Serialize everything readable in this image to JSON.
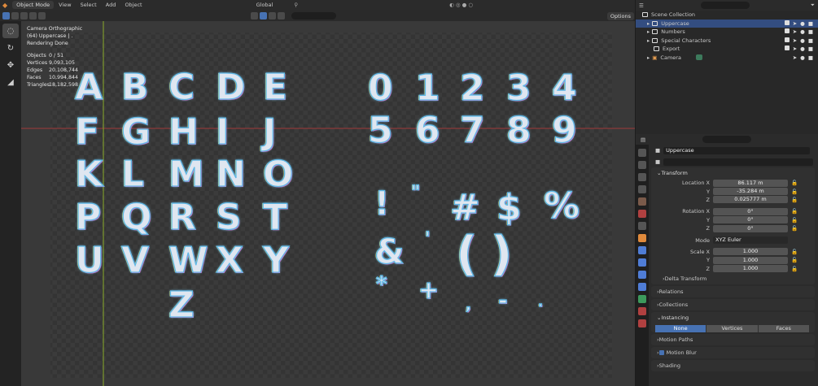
{
  "header": {
    "mode": "Object Mode",
    "menu": [
      "View",
      "Select",
      "Add",
      "Object"
    ],
    "orientation": "Global",
    "options": "Options"
  },
  "overlay": {
    "camera": "Camera Orthographic",
    "collection": "(64) Uppercase | .",
    "status": "Rendering Done",
    "stats": [
      {
        "k": "Objects",
        "v": "0 / 51"
      },
      {
        "k": "Vertices",
        "v": "9,093,105"
      },
      {
        "k": "Edges",
        "v": "20,108,744"
      },
      {
        "k": "Faces",
        "v": "10,994,844"
      },
      {
        "k": "Triangles",
        "v": "18,182,598"
      }
    ]
  },
  "glyphs": {
    "uppercase": "ABCDEFGHIJKLMNOPQRSTUVWXYZ",
    "numbers": "0123456789",
    "special": [
      "!",
      "\"",
      "#",
      "$",
      "%",
      "&",
      "'",
      "(",
      ")",
      "*",
      "+",
      ",",
      "-",
      "."
    ]
  },
  "outliner": {
    "root": "Scene Collection",
    "items": [
      {
        "name": "Uppercase",
        "selected": true
      },
      {
        "name": "Numbers"
      },
      {
        "name": "Special Characters"
      },
      {
        "name": "Export"
      },
      {
        "name": "Camera"
      }
    ]
  },
  "properties": {
    "object_name": "Uppercase",
    "transform": {
      "title": "Transform",
      "location_label": "Location X",
      "rotation_label": "Rotation X",
      "scale_label": "Scale X",
      "y": "Y",
      "z": "Z",
      "location": [
        "86.117 m",
        "-35.284 m",
        "0.025777 m"
      ],
      "rotation": [
        "0°",
        "0°",
        "0°"
      ],
      "mode_label": "Mode",
      "mode": "XYZ Euler",
      "scale": [
        "1.000",
        "1.000",
        "1.000"
      ],
      "delta": "Delta Transform"
    },
    "relations": "Relations",
    "collections": "Collections",
    "instancing": {
      "title": "Instancing",
      "options": [
        "None",
        "Vertices",
        "Faces"
      ]
    },
    "motion_paths": "Motion Paths",
    "motion_blur": "Motion Blur",
    "shading": "Shading"
  },
  "colors": {
    "accent": "#4772b3",
    "selection": "#334d80",
    "red_axis": "#a13a3a",
    "green_axis": "#8aab2a"
  }
}
